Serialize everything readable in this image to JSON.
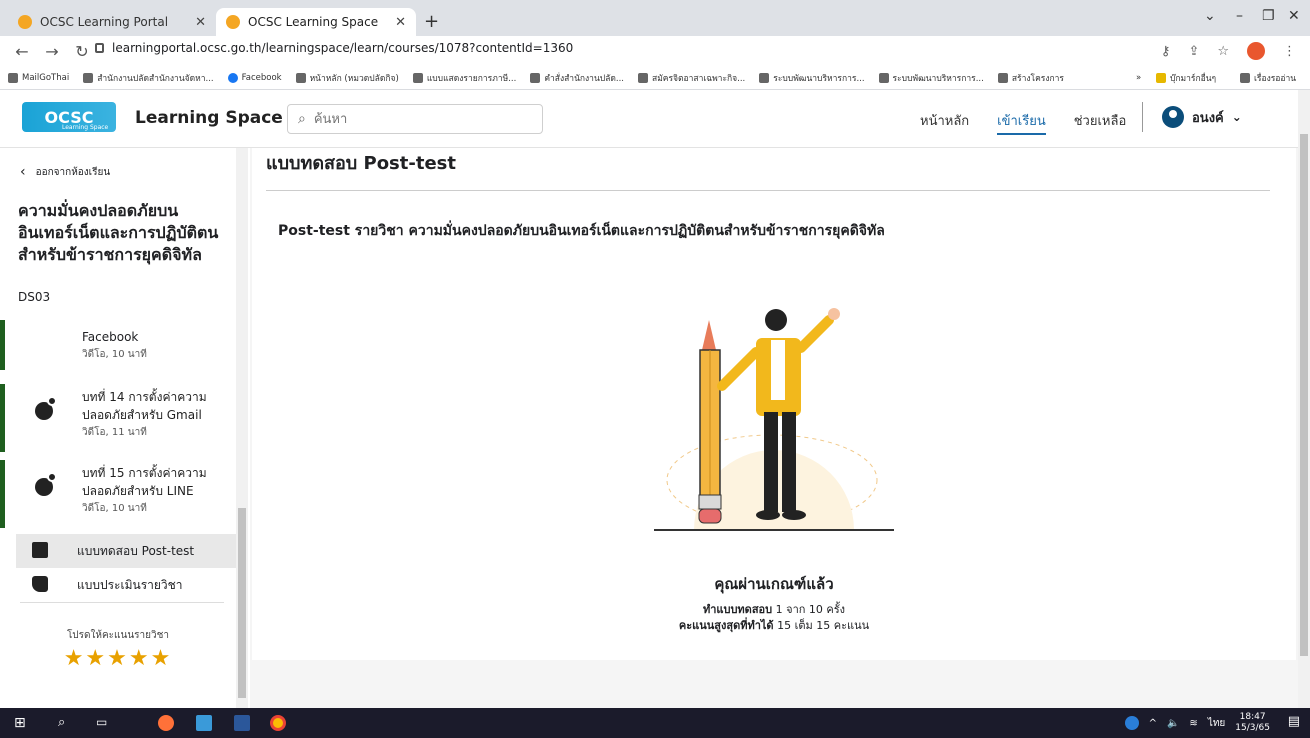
{
  "browser": {
    "tabs": [
      {
        "title": "OCSC Learning Portal"
      },
      {
        "title": "OCSC Learning Space"
      }
    ],
    "url": "learningportal.ocsc.go.th/learningspace/learn/courses/1078?contentId=1360",
    "bookmarks": [
      "MailGoThai",
      "สำนักงานปลัดสำนักงานจัดหา...",
      "Facebook",
      "หน้าหลัก (หมวดปลัดกิจ)",
      "แบบแสดงรายการภาษี...",
      "คำสั่งสำนักงานปลัด...",
      "สมัครจิตอาสาเฉพาะกิจ...",
      "ระบบพัฒนาบริหารการ...",
      "ระบบพัฒนาบริหารการ...",
      "สร้างโครงการ"
    ],
    "bookmarks_more": "»",
    "bookmarks_other": [
      "บุ๊กมาร์กอื่นๆ",
      "เรื่องรออ่าน"
    ]
  },
  "header": {
    "logo_text": "OCSC",
    "logo_sub": "Learning Space",
    "brand": "Learning Space",
    "search_placeholder": "ค้นหา",
    "nav": [
      "หน้าหลัก",
      "เข้าเรียน",
      "ช่วยเหลือ"
    ],
    "user_name": "อนงค์"
  },
  "sidebar": {
    "back_label": "ออกจากห้องเรียน",
    "course_title": "ความมั่นคงปลอดภัยบนอินเทอร์เน็ตและการปฏิบัติตนสำหรับข้าราชการยุคดิจิทัล",
    "course_code": "DS03",
    "partial_lesson": {
      "title": "Facebook",
      "meta": "วิดีโอ, 10 นาที"
    },
    "lessons": [
      {
        "title": "บทที่ 14 การตั้งค่าความปลอดภัยสำหรับ Gmail",
        "meta": "วิดีโอ, 11 นาที"
      },
      {
        "title": "บทที่ 15 การตั้งค่าความปลอดภัยสำหรับ LINE",
        "meta": "วิดีโอ, 10 นาที"
      }
    ],
    "posttest_label": "แบบทดสอบ Post-test",
    "evaluation_label": "แบบประเมินรายวิชา",
    "rate_label": "โปรดให้คะแนนรายวิชา",
    "stars": "★★★★★",
    "rating": 5
  },
  "main": {
    "title": "แบบทดสอบ Post-test",
    "subtitle": "Post-test รายวิชา ความมั่นคงปลอดภัยบนอินเทอร์เน็ตและการปฏิบัติตนสำหรับข้าราชการยุคดิจิทัล",
    "pass_text": "คุณผ่านเกณฑ์แล้ว",
    "attempts_label": "ทำแบบทดสอบ",
    "attempts_value": "1 จาก 10 ครั้ง",
    "score_label": "คะแนนสูงสุดที่ทำได้",
    "score_value": "15 เต็ม 15 คะแนน"
  },
  "taskbar": {
    "lang": "ไทย",
    "time": "18:47",
    "date": "15/3/65"
  },
  "colors": {
    "accent": "#1a6aa9",
    "progress_bar": "#1f5f1f",
    "star": "#e8a100"
  }
}
